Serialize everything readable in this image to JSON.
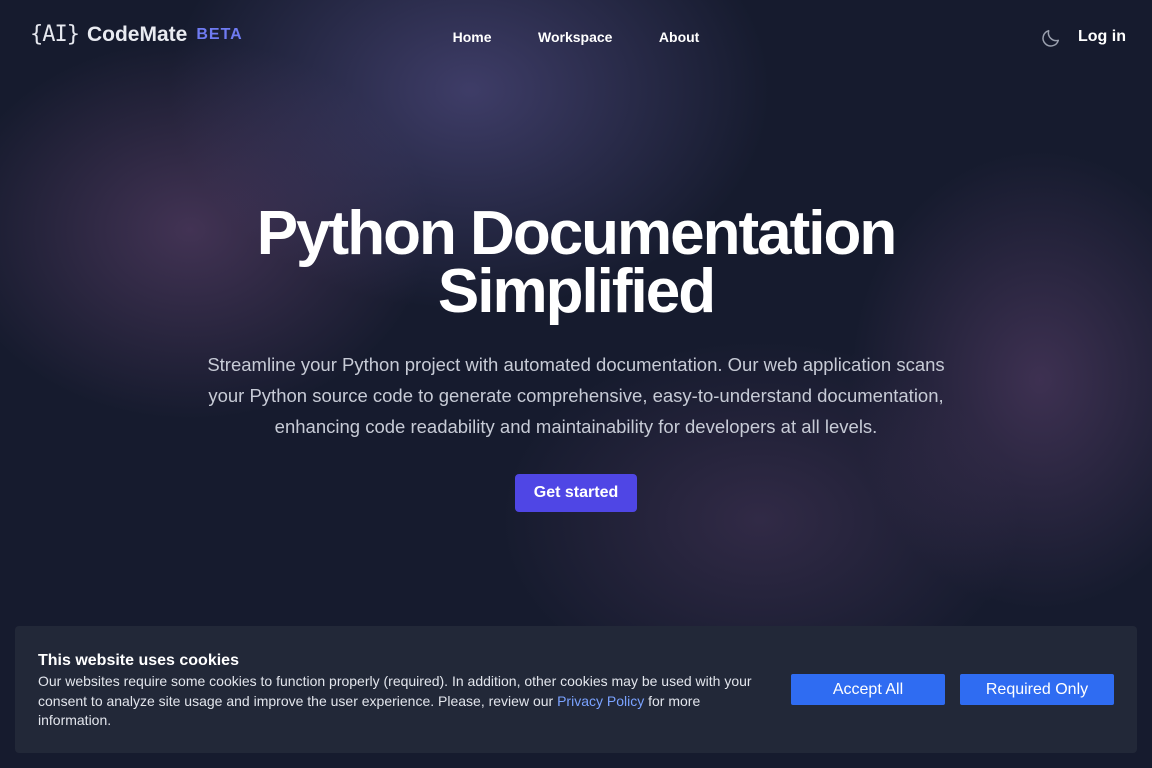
{
  "header": {
    "logo_mark": "{AI}",
    "brand": "CodeMate",
    "badge": "BETA",
    "nav": [
      {
        "label": "Home"
      },
      {
        "label": "Workspace"
      },
      {
        "label": "About"
      }
    ],
    "theme_icon": "moon-icon",
    "login_label": "Log in"
  },
  "hero": {
    "title": "Python Documentation Simplified",
    "description": "Streamline your Python project with automated documentation. Our web application scans your Python source code to generate comprehensive, easy-to-understand documentation, enhancing code readability and maintainability for developers at all levels.",
    "cta_label": "Get started"
  },
  "cookie_banner": {
    "title": "This website uses cookies",
    "text_before": "Our websites require some cookies to function properly (required). In addition, other cookies may be used with your consent to analyze site usage and improve the user experience. Please, review our ",
    "link_label": "Privacy Policy",
    "text_after": " for more information.",
    "accept_all_label": "Accept All",
    "required_only_label": "Required Only"
  },
  "colors": {
    "background": "#161b2e",
    "accent": "#4f46e5",
    "badge": "#6f7bf2",
    "cookie_button": "#2f6cf2",
    "link": "#7aa2ff"
  }
}
